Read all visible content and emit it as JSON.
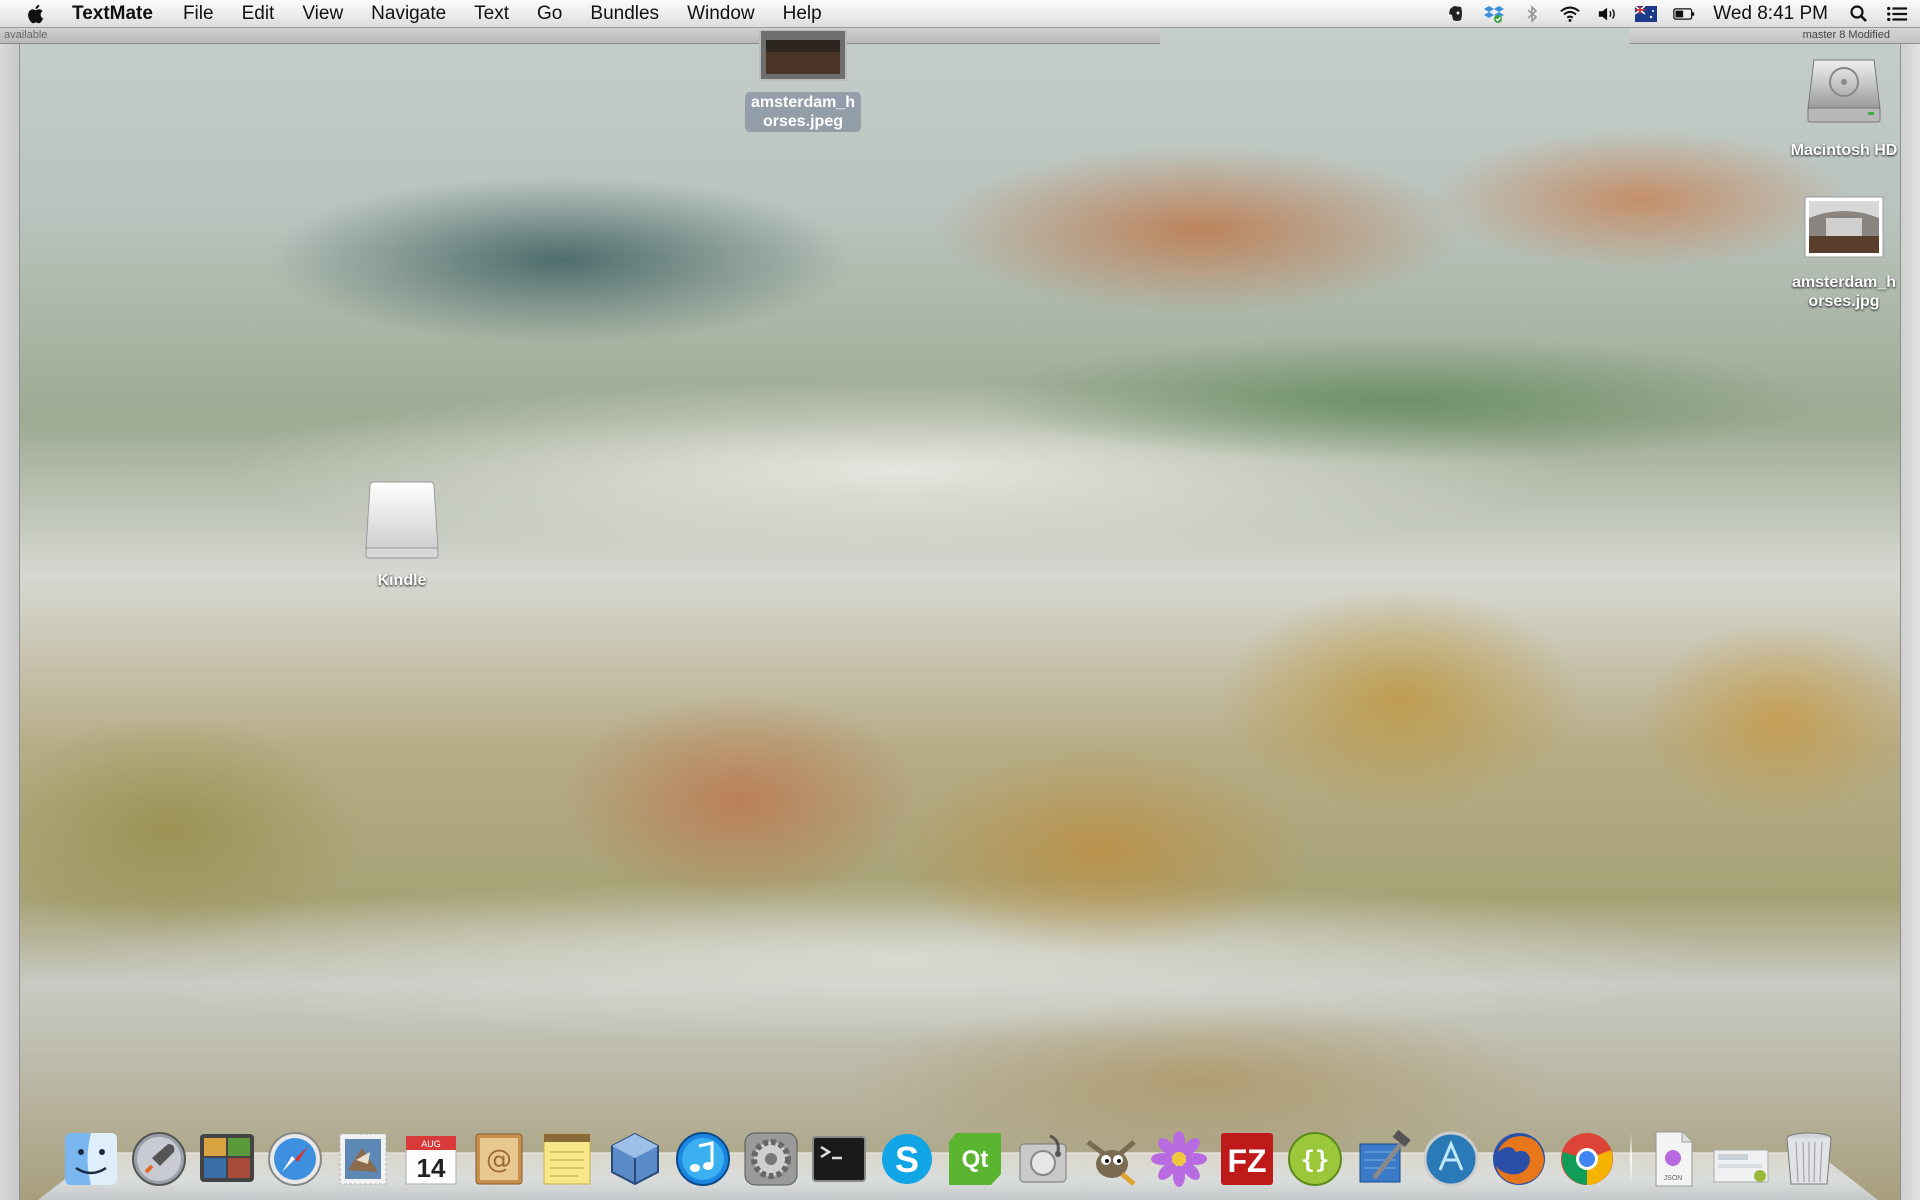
{
  "menubar": {
    "app_name": "TextMate",
    "menus": [
      "File",
      "Edit",
      "View",
      "Navigate",
      "Text",
      "Go",
      "Bundles",
      "Window",
      "Help"
    ],
    "clock": "Wed 8:41 PM",
    "status_icons": [
      "evernote-icon",
      "dropbox-icon",
      "bluetooth-icon",
      "wifi-icon",
      "volume-icon",
      "flag-icon",
      "battery-icon"
    ]
  },
  "window_fragments": {
    "top_left_text": "available",
    "top_right_text": "master  8 Modified"
  },
  "desktop": {
    "files": [
      {
        "name": "amsterdam_horses.jpeg",
        "line1": "amsterdam_h",
        "line2": "orses.jpeg",
        "selected": true
      },
      {
        "name": "Macintosh HD",
        "line1": "Macintosh HD"
      },
      {
        "name": "amsterdam_horses.jpg",
        "line1": "amsterdam_h",
        "line2": "orses.jpg"
      },
      {
        "name": "Kindle",
        "line1": "Kindle"
      }
    ]
  },
  "dock": {
    "apps": [
      "Finder",
      "Launchpad",
      "Photo Slideshow",
      "Safari",
      "Mail",
      "Calendar",
      "Contacts",
      "Notes",
      "VirtualBox",
      "iTunes",
      "System Preferences",
      "Terminal",
      "Skype",
      "Qt Creator",
      "Disk Utility",
      "GIMP",
      "Flower",
      "FileZilla",
      "Brackets",
      "Xcode",
      "Atom",
      "Firefox",
      "Chrome"
    ],
    "calendar_day": "14",
    "calendar_month": "AUG",
    "stack_label": "JSON"
  }
}
